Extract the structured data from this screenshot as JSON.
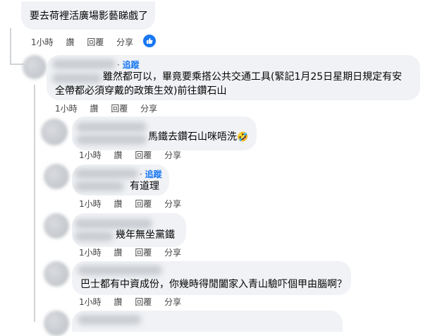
{
  "actions": {
    "time": "1小時",
    "like": "讚",
    "reply": "回覆",
    "share": "分享"
  },
  "follow_label": "追蹤",
  "comments": [
    {
      "text": "要去荷裡活廣場影藝睇戲了"
    },
    {
      "text_line1": "雖然都可以，畢竟要乘搭公共交通工具(緊記1月25日星期日規定有安",
      "text_line2": "全帶都必須穿戴的政策生效)前往鑽石山"
    },
    {
      "text": "馬鐵去鑽石山咪唔洗",
      "emoji": "🤣"
    },
    {
      "text": "有道理"
    },
    {
      "text": "幾年無坐黨鐵"
    },
    {
      "text": "巴士都有中資成份，你幾時得閒闔家入青山驗吓個甲由腦啊？"
    }
  ],
  "colors": {
    "bubble": "#f0f2f5",
    "link_blue": "#1877f2",
    "secondary_text": "#65676b"
  }
}
